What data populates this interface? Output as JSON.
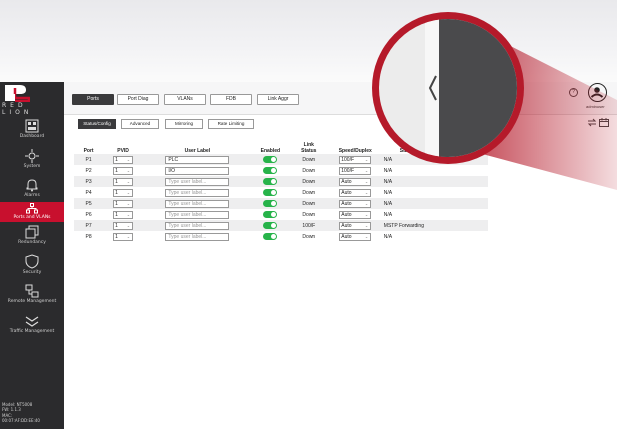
{
  "brand": {
    "word": "RED LION"
  },
  "sidebar": {
    "items": [
      {
        "label": "Dashboard",
        "icon": "dashboard-icon"
      },
      {
        "label": "System",
        "icon": "system-icon"
      },
      {
        "label": "Alarms",
        "icon": "bell-icon"
      },
      {
        "label": "Ports and VLANs",
        "icon": "network-icon"
      },
      {
        "label": "Redundancy",
        "icon": "redundancy-icon"
      },
      {
        "label": "Security",
        "icon": "shield-icon"
      },
      {
        "label": "Remote Management",
        "icon": "remote-icon"
      },
      {
        "label": "Traffic Management",
        "icon": "traffic-icon"
      }
    ],
    "active": "Ports and VLANs",
    "device": {
      "model": "Model: NT5008",
      "fw": "FW: 1.1.3",
      "mac_label": "MAC:",
      "mac": "00:07:AF:DD:EE:40"
    }
  },
  "header": {
    "user": "adminuser",
    "help": "?"
  },
  "tabs": [
    "Ports",
    "Port Diag",
    "VLANs",
    "FDB",
    "Link Aggr"
  ],
  "subtabs": [
    "Status/Config",
    "Advanced",
    "Mirroring",
    "Rate Limiting"
  ],
  "table": {
    "headers": {
      "port": "Port",
      "pvid": "PVID",
      "label": "User Label",
      "enabled": "Enabled",
      "link_top": "Link",
      "link": "Status",
      "speed": "Speed/Duplex",
      "state": "State"
    },
    "placeholder": "Type user label...",
    "rows": [
      {
        "port": "P1",
        "pvid": "1",
        "label": "PLC",
        "link": "Down",
        "speed": "100/F",
        "state": "N/A"
      },
      {
        "port": "P2",
        "pvid": "1",
        "label": "I/O",
        "link": "Down",
        "speed": "100/F",
        "state": "N/A"
      },
      {
        "port": "P3",
        "pvid": "1",
        "label": "",
        "link": "Down",
        "speed": "Auto",
        "state": "N/A"
      },
      {
        "port": "P4",
        "pvid": "1",
        "label": "",
        "link": "Down",
        "speed": "Auto",
        "state": "N/A"
      },
      {
        "port": "P5",
        "pvid": "1",
        "label": "",
        "link": "Down",
        "speed": "Auto",
        "state": "N/A"
      },
      {
        "port": "P6",
        "pvid": "1",
        "label": "",
        "link": "Down",
        "speed": "Auto",
        "state": "N/A"
      },
      {
        "port": "P7",
        "pvid": "1",
        "label": "",
        "link": "100/F",
        "speed": "Auto",
        "state": "MSTP Forwarding"
      },
      {
        "port": "P8",
        "pvid": "1",
        "label": "",
        "link": "Down",
        "speed": "Auto",
        "state": "N/A"
      }
    ]
  },
  "colors": {
    "accent": "#c8102e",
    "sidebar": "#2b2b2d",
    "toggle_on": "#27b34a"
  }
}
